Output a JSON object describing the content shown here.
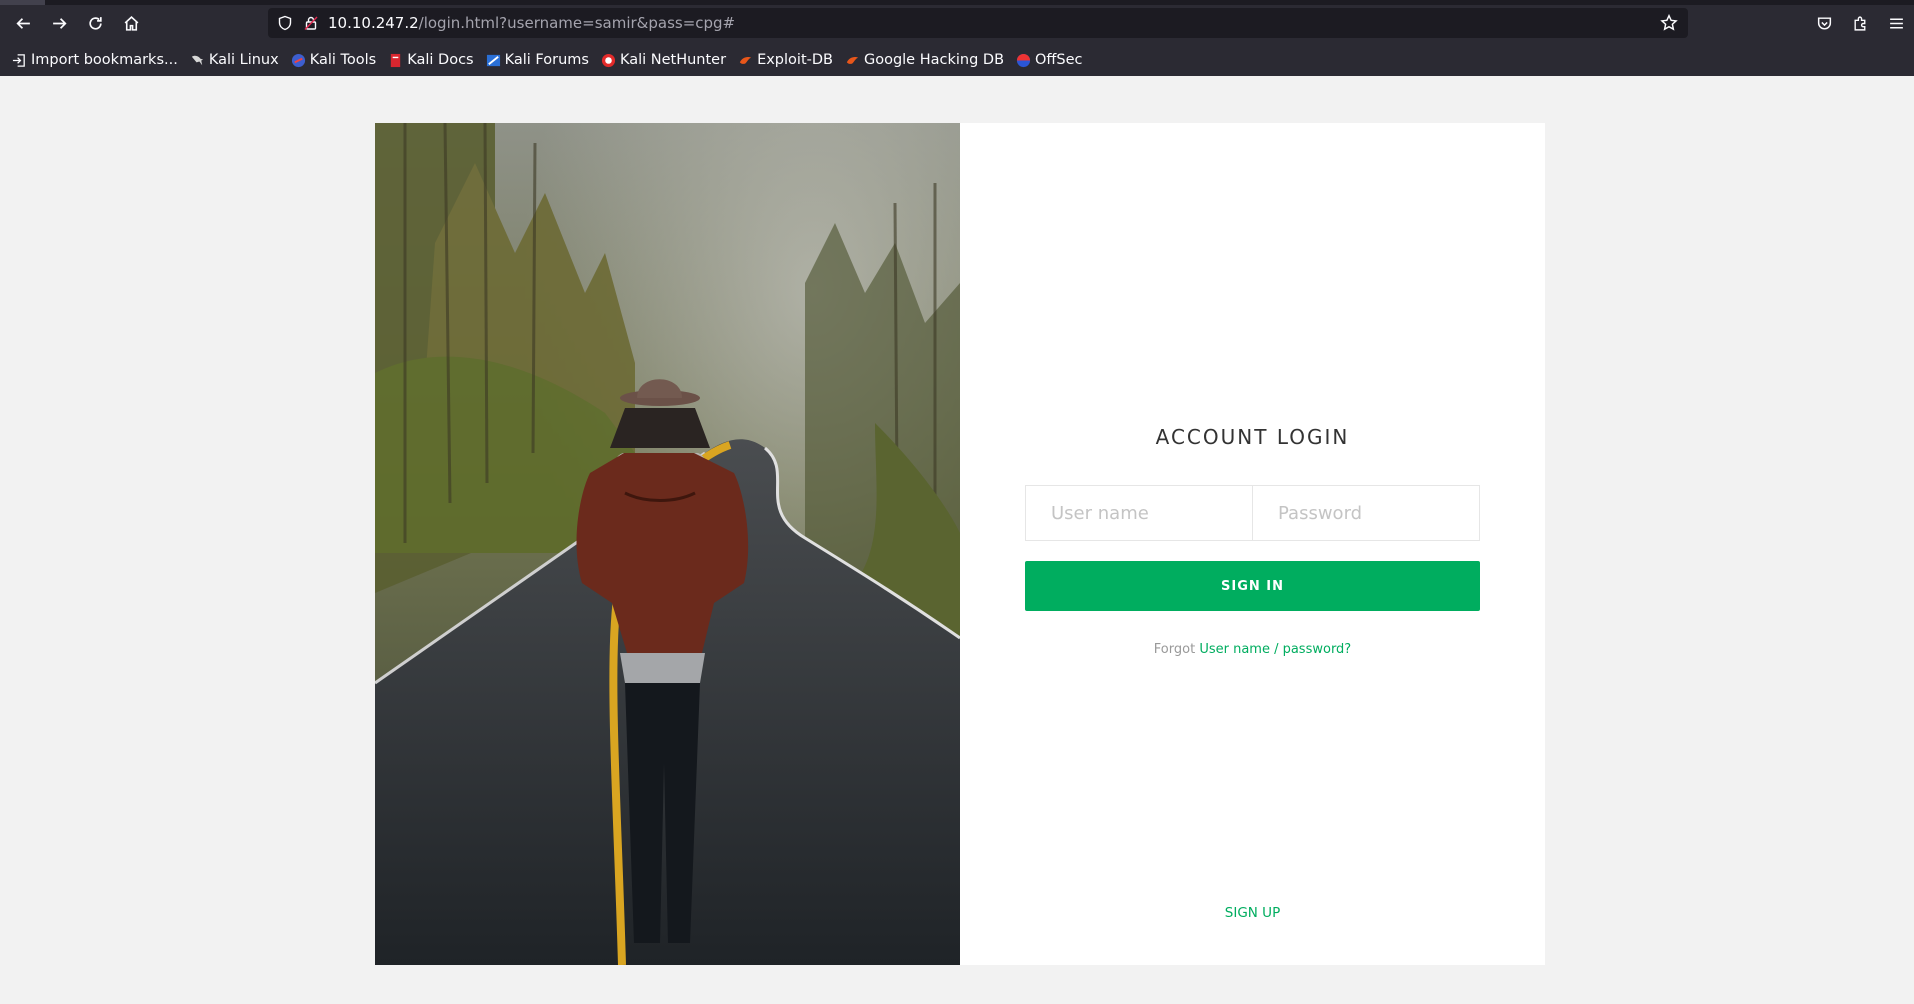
{
  "browser": {
    "url_host": "10.10.247.2",
    "url_path": "/login.html?username=samir&pass=cpg#",
    "bookmarks": [
      {
        "label": "Import bookmarks...",
        "icon": "import-icon"
      },
      {
        "label": "Kali Linux",
        "icon": "kali-dragon-icon"
      },
      {
        "label": "Kali Tools",
        "icon": "kali-tools-icon"
      },
      {
        "label": "Kali Docs",
        "icon": "kali-docs-icon"
      },
      {
        "label": "Kali Forums",
        "icon": "kali-forums-icon"
      },
      {
        "label": "Kali NetHunter",
        "icon": "nethunter-icon"
      },
      {
        "label": "Exploit-DB",
        "icon": "exploit-db-icon"
      },
      {
        "label": "Google Hacking DB",
        "icon": "ghdb-icon"
      },
      {
        "label": "OffSec",
        "icon": "offsec-icon"
      }
    ]
  },
  "login": {
    "title": "ACCOUNT LOGIN",
    "username_placeholder": "User name",
    "password_placeholder": "Password",
    "signin_label": "SIGN IN",
    "forgot_prefix": "Forgot",
    "forgot_link": "User name / password?",
    "signup_label": "SIGN UP"
  },
  "colors": {
    "accent": "#00ad5f",
    "browser_bg": "#2b2a33",
    "page_bg": "#f2f2f2"
  }
}
